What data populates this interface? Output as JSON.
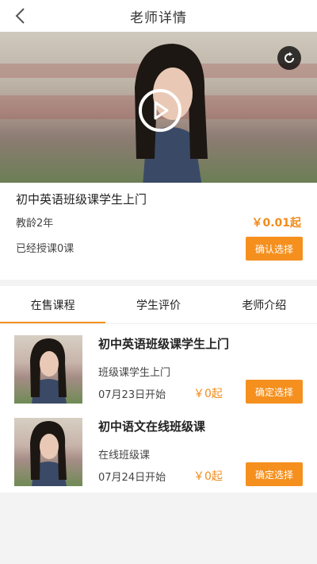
{
  "header": {
    "title": "老师详情"
  },
  "teacher": {
    "course_title": "初中英语班级课学生上门",
    "teaching_years": "教龄2年",
    "price": "￥0.01起",
    "taught_count": "已经授课0课",
    "confirm_label": "确认选择"
  },
  "tabs": [
    {
      "label": "在售课程",
      "active": true
    },
    {
      "label": "学生评价",
      "active": false
    },
    {
      "label": "老师介绍",
      "active": false
    }
  ],
  "courses": [
    {
      "title": "初中英语班级课学生上门",
      "subtitle": "班级课学生上门",
      "start": "07月23日开始",
      "price": "￥0起",
      "button": "确定选择"
    },
    {
      "title": "初中语文在线班级课",
      "subtitle": "在线班级课",
      "start": "07月24日开始",
      "price": "￥0起",
      "button": "确定选择"
    }
  ],
  "colors": {
    "accent": "#f5901e",
    "price": "#f08c1c"
  },
  "icons": {
    "back": "chevron-left-icon",
    "play": "play-icon",
    "replay": "replay-icon"
  }
}
